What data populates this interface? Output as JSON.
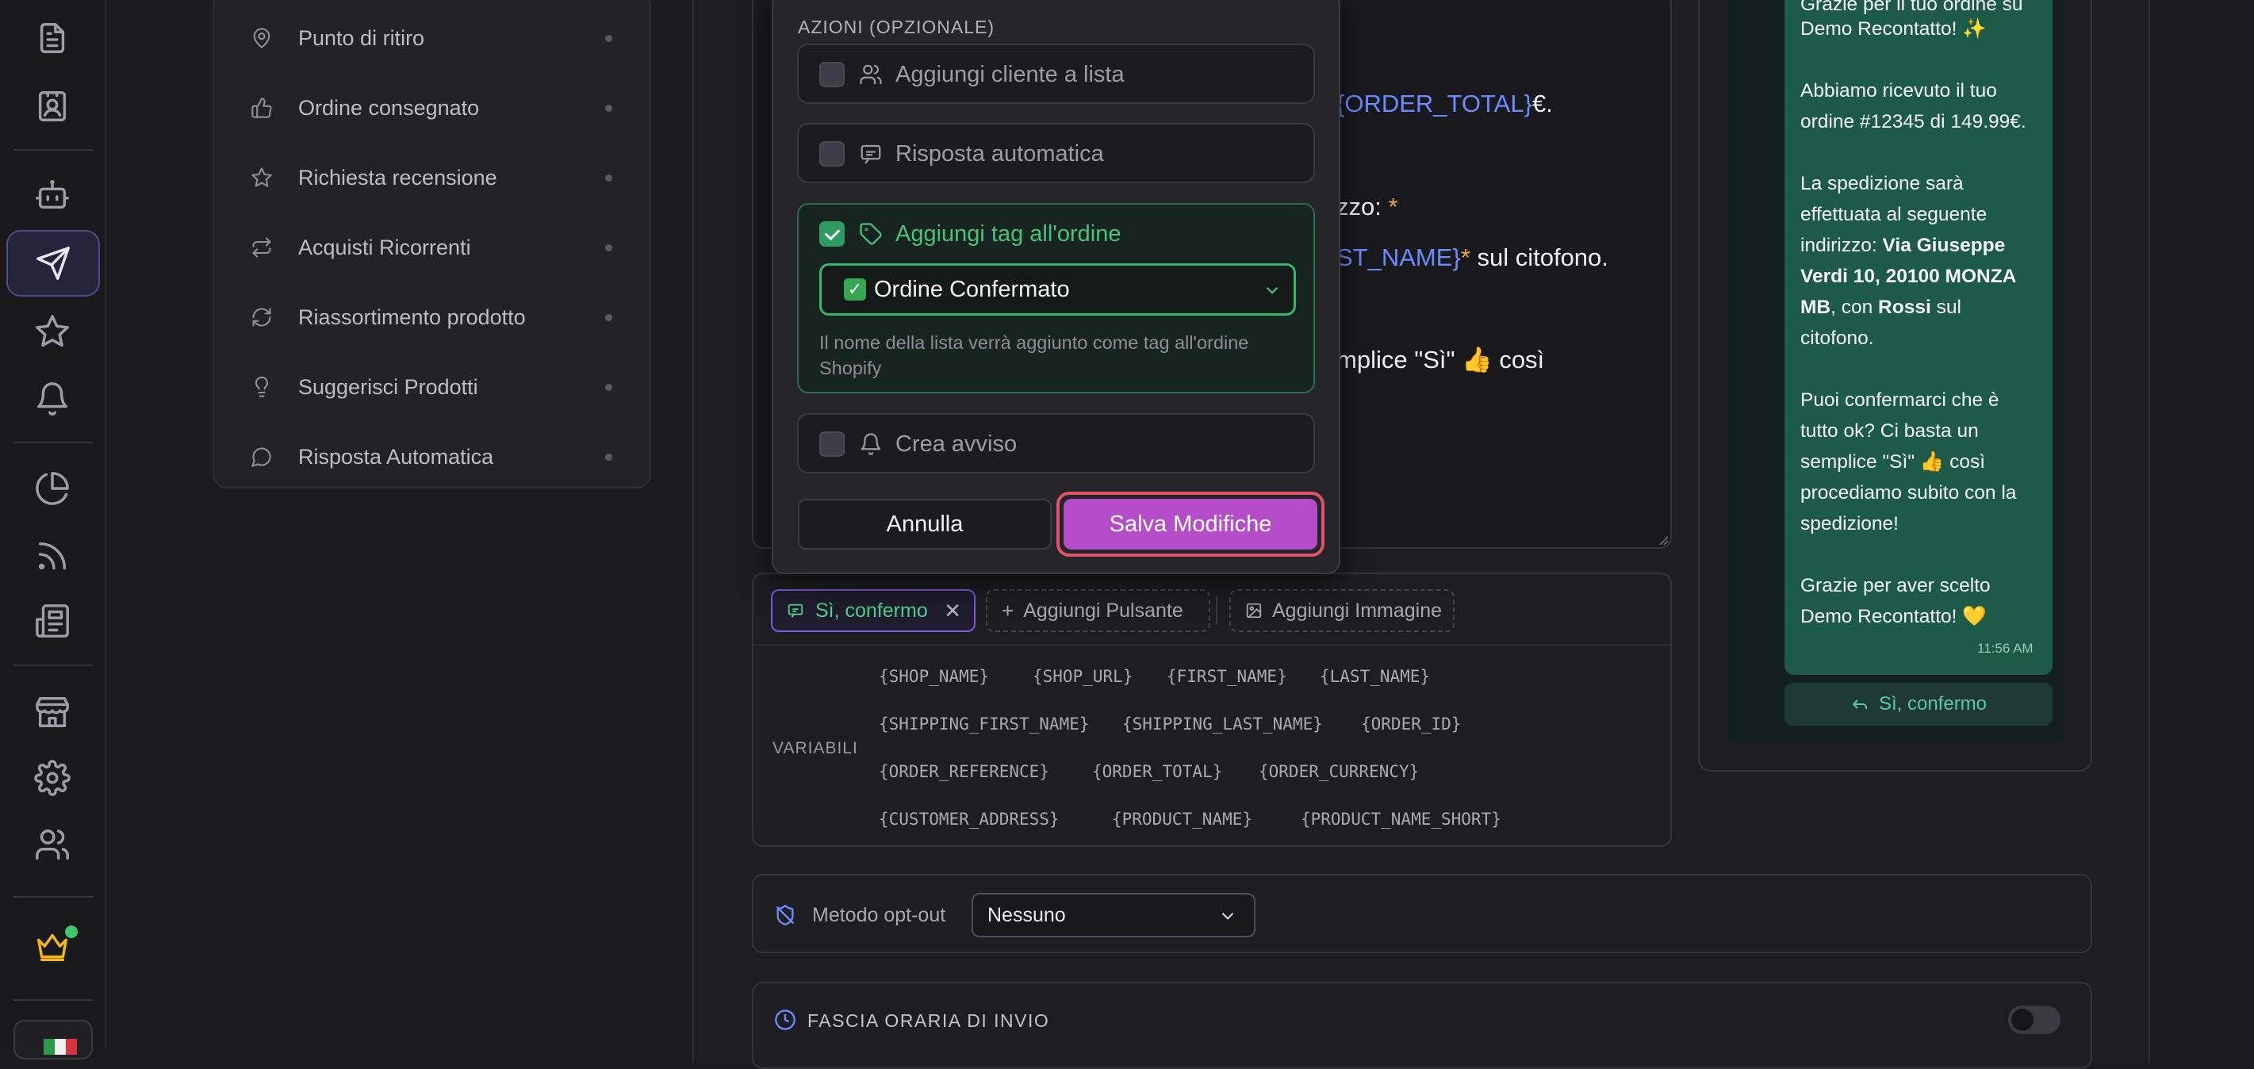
{
  "rail": {
    "icons": [
      "document-icon",
      "contact-card-icon",
      "bot-icon",
      "send-icon",
      "star-icon",
      "bell-icon",
      "pie-chart-icon",
      "rss-icon",
      "newspaper-icon",
      "store-icon",
      "settings-icon",
      "users-icon",
      "crown-icon"
    ],
    "active": "send-icon",
    "status_color": "#3cc86b"
  },
  "menu": {
    "items": [
      {
        "label": "Punto di ritiro",
        "icon": "map-pin-icon"
      },
      {
        "label": "Ordine consegnato",
        "icon": "thumbs-up-icon"
      },
      {
        "label": "Richiesta recensione",
        "icon": "star-icon"
      },
      {
        "label": "Acquisti Ricorrenti",
        "icon": "repeat-icon"
      },
      {
        "label": "Riassortimento prodotto",
        "icon": "refresh-icon"
      },
      {
        "label": "Suggerisci Prodotti",
        "icon": "lightbulb-icon"
      },
      {
        "label": "Risposta Automatica",
        "icon": "chat-bubble-icon"
      }
    ]
  },
  "editor": {
    "line1_var": "{ORDER_TOTAL}",
    "line1_suffix": "€.",
    "line2_text": "zzo:",
    "line2_star": "*",
    "line3_var": "ST_NAME}",
    "line3_star": "*",
    "line3_suffix": " sul citofono.",
    "line4_text": "mplice \"Sì\" 👍 così"
  },
  "buttons": {
    "confirm_chip": "Sì, confermo",
    "add_button": "Aggiungi Pulsante",
    "add_image": "Aggiungi Immagine"
  },
  "variables": {
    "label": "VARIABILI",
    "rows": [
      [
        "{SHOP_NAME}",
        "{SHOP_URL}",
        "{FIRST_NAME}",
        "{LAST_NAME}"
      ],
      [
        "{SHIPPING_FIRST_NAME}",
        "{SHIPPING_LAST_NAME}",
        "{ORDER_ID}"
      ],
      [
        "{ORDER_REFERENCE}",
        "{ORDER_TOTAL}",
        "{ORDER_CURRENCY}"
      ],
      [
        "{CUSTOMER_ADDRESS}",
        "{PRODUCT_NAME}",
        "{PRODUCT_NAME_SHORT}"
      ]
    ]
  },
  "optout": {
    "label": "Metodo opt-out",
    "value": "Nessuno"
  },
  "timeband": {
    "label": "FASCIA ORARIA DI INVIO",
    "enabled": false
  },
  "preview": {
    "lines": [
      {
        "text": "Grazie per il tuo ordine su"
      },
      {
        "text": "Demo Recontatto! ✨"
      },
      {
        "text": ""
      },
      {
        "text": "Abbiamo ricevuto il tuo"
      },
      {
        "text": "ordine #12345 di 149.99€."
      },
      {
        "text": ""
      },
      {
        "text": "La spedizione sarà"
      },
      {
        "text": "effettuata al seguente"
      },
      {
        "text": "indirizzo: ",
        "bold": "Via Giuseppe"
      },
      {
        "bold": "Verdi 10, 20100 MONZA"
      },
      {
        "bold": "MB",
        "text": ", con ",
        "bold2": "Rossi",
        "text2": " sul"
      },
      {
        "text": "citofono."
      },
      {
        "text": ""
      },
      {
        "text": "Puoi confermarci che è"
      },
      {
        "text": "tutto ok? Ci basta un"
      },
      {
        "text": "semplice \"Sì\" 👍 così"
      },
      {
        "text": "procediamo subito con la"
      },
      {
        "text": "spedizione!"
      },
      {
        "text": ""
      },
      {
        "text": "Grazie per aver scelto"
      },
      {
        "text": "Demo Recontatto! 💛"
      }
    ],
    "time": "11:56 AM",
    "reply": "Sì, confermo"
  },
  "modal": {
    "heading": "AZIONI (OPZIONALE)",
    "options": [
      {
        "label": "Aggiungi cliente a lista",
        "checked": false
      },
      {
        "label": "Risposta automatica",
        "checked": false
      },
      {
        "label": "Aggiungi tag all'ordine",
        "checked": true
      },
      {
        "label": "Crea avviso",
        "checked": false
      }
    ],
    "tag_value": "Ordine Confermato",
    "hint": "Il nome della lista verrà aggiunto come tag all'ordine Shopify",
    "cancel": "Annulla",
    "save": "Salva Modifiche"
  }
}
